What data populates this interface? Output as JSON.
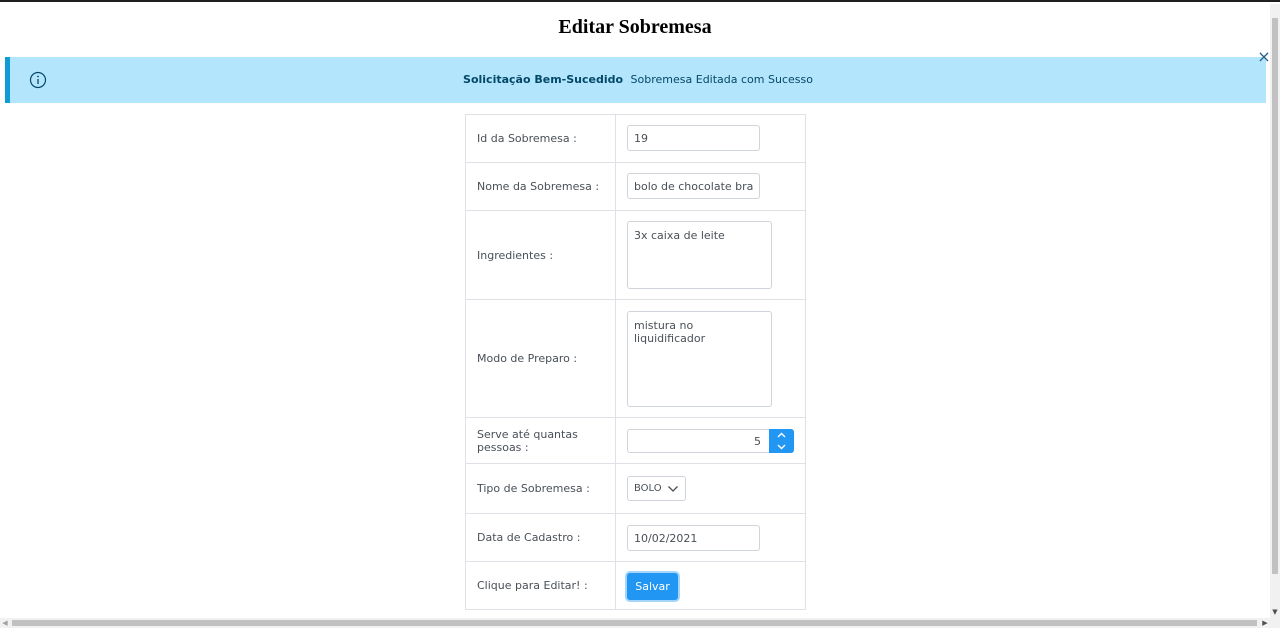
{
  "page": {
    "title": "Editar Sobremesa"
  },
  "alert": {
    "summary": "Solicitação Bem-Sucedido",
    "detail": "Sobremesa Editada com Sucesso",
    "close_symbol": "×",
    "icon": "info-circle-icon",
    "colors": {
      "background": "#b3e5fc",
      "border": "#0f9bd7",
      "text": "#044868"
    }
  },
  "form": {
    "id_label": "Id da Sobremesa :",
    "id_value": "19",
    "nome_label": "Nome da Sobremesa :",
    "nome_value": "bolo de chocolate branco",
    "ingredientes_label": "Ingredientes :",
    "ingredientes_value": "3x caixa de leite",
    "modo_label": "Modo de Preparo :",
    "modo_value": "mistura no liquidificador",
    "serve_label": "Serve até quantas pessoas :",
    "serve_value": "5",
    "tipo_label": "Tipo de Sobremesa :",
    "tipo_value": "BOLO",
    "data_label": "Data de Cadastro :",
    "data_value": "10/02/2021",
    "editar_label": "Clique para Editar! :",
    "save_button": "Salvar"
  },
  "theme": {
    "accent": "#2196f3",
    "border": "#dee2e6"
  }
}
